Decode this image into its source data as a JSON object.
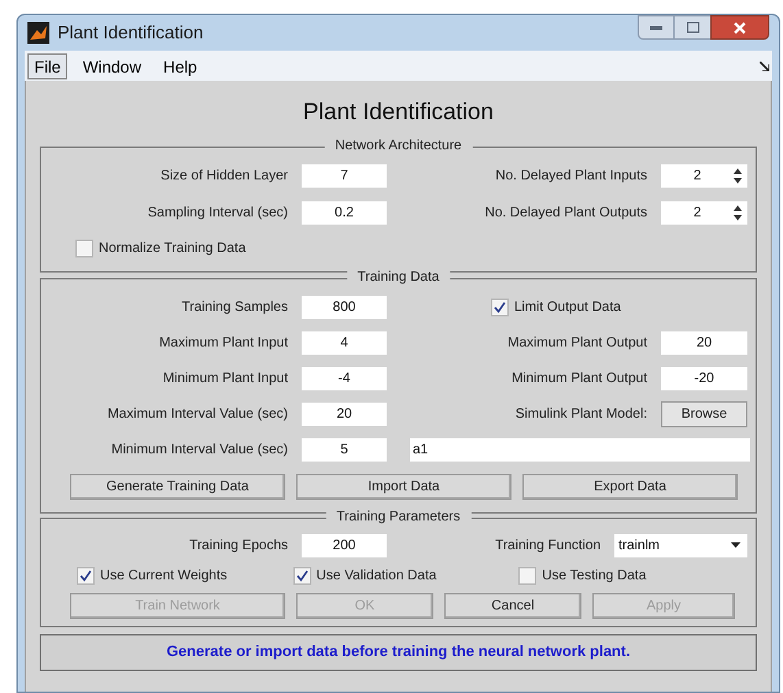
{
  "window": {
    "title": "Plant Identification"
  },
  "menu": [
    {
      "label": "File",
      "selected": true
    },
    {
      "label": "Window",
      "selected": false
    },
    {
      "label": "Help",
      "selected": false
    }
  ],
  "heading": "Plant Identification",
  "network_architecture": {
    "title": "Network Architecture",
    "rows": [
      {
        "label": "Size of Hidden Layer",
        "value": "7",
        "right_label": "No. Delayed Plant Inputs",
        "right_value": "2"
      },
      {
        "label": "Sampling Interval (sec)",
        "value": "0.2",
        "right_label": "No. Delayed Plant Outputs",
        "right_value": "2"
      }
    ],
    "normalize": {
      "label": "Normalize Training Data",
      "checked": false
    }
  },
  "training_data": {
    "title": "Training Data",
    "samples": {
      "label": "Training Samples",
      "value": "800"
    },
    "limit_output": {
      "label": "Limit Output Data",
      "checked": true
    },
    "rows": [
      {
        "label": "Maximum Plant Input",
        "value": "4",
        "right_label": "Maximum Plant Output",
        "right_value": "20"
      },
      {
        "label": "Minimum Plant Input",
        "value": "-4",
        "right_label": "Minimum Plant Output",
        "right_value": "-20"
      }
    ],
    "max_interval": {
      "label": "Maximum Interval Value (sec)",
      "value": "20"
    },
    "simulink": {
      "label": "Simulink Plant Model:",
      "button": "Browse"
    },
    "min_interval": {
      "label": "Minimum Interval Value (sec)",
      "value": "5"
    },
    "model_name": "a1",
    "buttons": [
      {
        "label": "Generate Training Data",
        "disabled": false
      },
      {
        "label": "Import Data",
        "disabled": false
      },
      {
        "label": "Export Data",
        "disabled": false
      }
    ]
  },
  "training_parameters": {
    "title": "Training Parameters",
    "epochs": {
      "label": "Training Epochs",
      "value": "200"
    },
    "function": {
      "label": "Training Function",
      "value": "trainlm"
    },
    "checkboxes": [
      {
        "label": "Use Current Weights",
        "checked": true
      },
      {
        "label": "Use Validation Data",
        "checked": true
      },
      {
        "label": "Use Testing Data",
        "checked": false
      }
    ],
    "buttons": [
      {
        "label": "Train Network",
        "disabled": true
      },
      {
        "label": "OK",
        "disabled": true
      },
      {
        "label": "Cancel",
        "disabled": false
      },
      {
        "label": "Apply",
        "disabled": true
      }
    ]
  },
  "status": "Generate or import data before training the neural network plant."
}
